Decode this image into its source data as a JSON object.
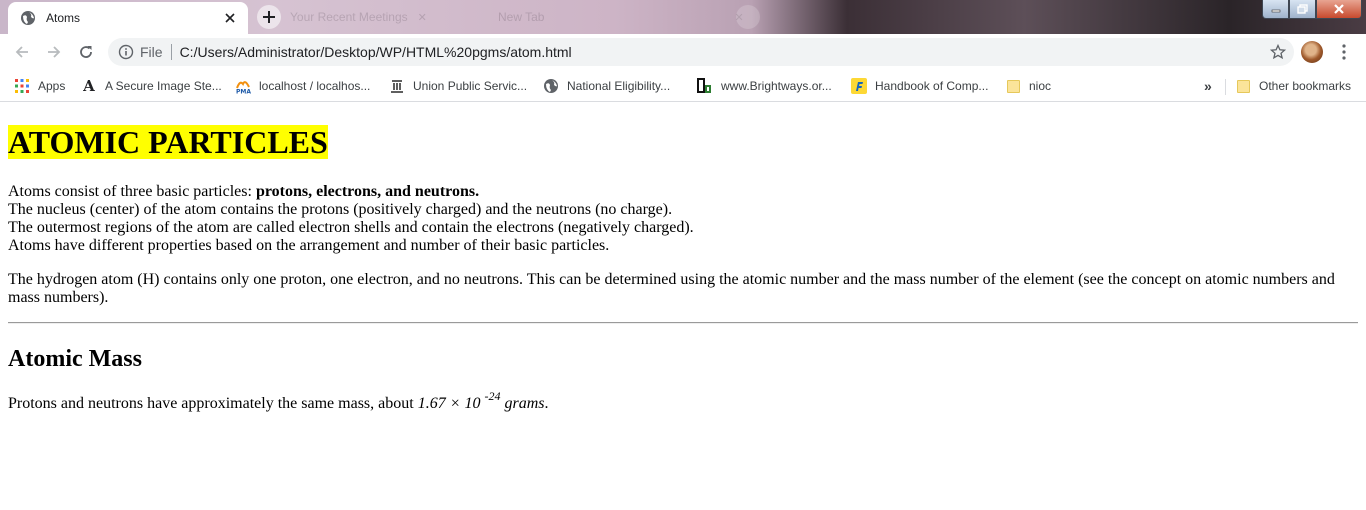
{
  "browser": {
    "active_tab": {
      "title": "Atoms",
      "favicon": "globe-icon"
    },
    "background_tabs": [
      {
        "title": "Your Recent Meetings"
      },
      {
        "title": "New Tab"
      }
    ],
    "new_tab_symbol": "+",
    "address_bar": {
      "scheme_label": "File",
      "url": "C:/Users/Administrator/Desktop/WP/HTML%20pgms/atom.html"
    },
    "bookmarks": [
      {
        "label": "Apps",
        "icon": "apps-grid-icon"
      },
      {
        "label": "A Secure Image Ste...",
        "icon": "letter-a-icon"
      },
      {
        "label": "localhost / localhos...",
        "icon": "phpmyadmin-icon"
      },
      {
        "label": "Union Public Servic...",
        "icon": "emblem-icon"
      },
      {
        "label": "National Eligibility...",
        "icon": "globe-icon"
      },
      {
        "label": "www.Brightways.or...",
        "icon": "brightways-icon"
      },
      {
        "label": "Handbook of Comp...",
        "icon": "flipkart-icon"
      },
      {
        "label": "nioc",
        "icon": "folder-icon"
      }
    ],
    "overflow_label": "»",
    "other_bookmarks": "Other bookmarks"
  },
  "page": {
    "title": "ATOMIC PARTICLES",
    "intro_text": "Atoms consist of three basic particles: ",
    "intro_bold": "protons, electrons, and neutrons.",
    "lines": [
      "The nucleus (center) of the atom contains the protons (positively charged) and the neutrons (no charge).",
      "The outermost regions of the atom are called electron shells and contain the electrons (negatively charged).",
      "Atoms have different properties based on the arrangement and number of their basic particles."
    ],
    "hydrogen_paragraph": "The hydrogen atom (H) contains only one proton, one electron, and no neutrons. This can be determined using the atomic number and the mass number of the element (see the concept on atomic numbers and mass numbers).",
    "section_heading": "Atomic Mass",
    "mass_text": "Protons and neutrons have approximately the same mass, about ",
    "mass_value": "1.67 × 10",
    "mass_exponent": "-24",
    "mass_unit": " grams",
    "mass_end": "."
  }
}
